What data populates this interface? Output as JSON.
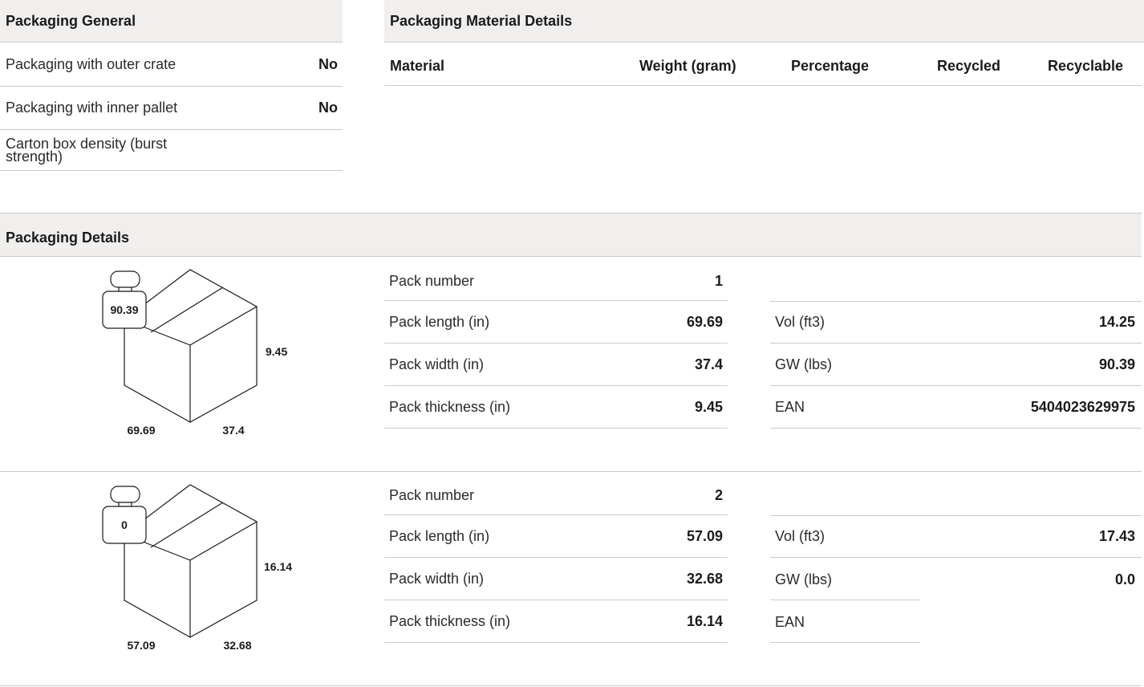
{
  "general": {
    "title": "Packaging General",
    "rows": [
      {
        "label": "Packaging with outer crate",
        "value": "No"
      },
      {
        "label": "Packaging with inner pallet",
        "value": "No"
      },
      {
        "label": "Carton box density (burst strength)",
        "value": ""
      }
    ]
  },
  "material": {
    "title": "Packaging Material Details",
    "columns": [
      "Material",
      "Weight (gram)",
      "Percentage",
      "Recycled",
      "Recyclable"
    ]
  },
  "details": {
    "title": "Packaging Details",
    "packs": [
      {
        "weight_tag": "90.39",
        "height_label": "9.45",
        "length_label": "69.69",
        "width_label": "37.4",
        "left": [
          {
            "label": "Pack number",
            "value": "1"
          },
          {
            "label": "Pack length (in)",
            "value": "69.69"
          },
          {
            "label": "Pack width (in)",
            "value": "37.4"
          },
          {
            "label": "Pack thickness (in)",
            "value": "9.45"
          }
        ],
        "right": [
          {
            "label": "Vol (ft3)",
            "value": "14.25"
          },
          {
            "label": "GW (lbs)",
            "value": "90.39"
          },
          {
            "label": "EAN",
            "value": "5404023629975"
          }
        ]
      },
      {
        "weight_tag": "0",
        "height_label": "16.14",
        "length_label": "57.09",
        "width_label": "32.68",
        "left": [
          {
            "label": "Pack number",
            "value": "2"
          },
          {
            "label": "Pack length (in)",
            "value": "57.09"
          },
          {
            "label": "Pack width (in)",
            "value": "32.68"
          },
          {
            "label": "Pack thickness (in)",
            "value": "16.14"
          }
        ],
        "right": [
          {
            "label": "Vol (ft3)",
            "value": "17.43"
          },
          {
            "label": "GW (lbs)",
            "value": "0.0"
          },
          {
            "label": "EAN",
            "value": ""
          }
        ]
      }
    ]
  }
}
